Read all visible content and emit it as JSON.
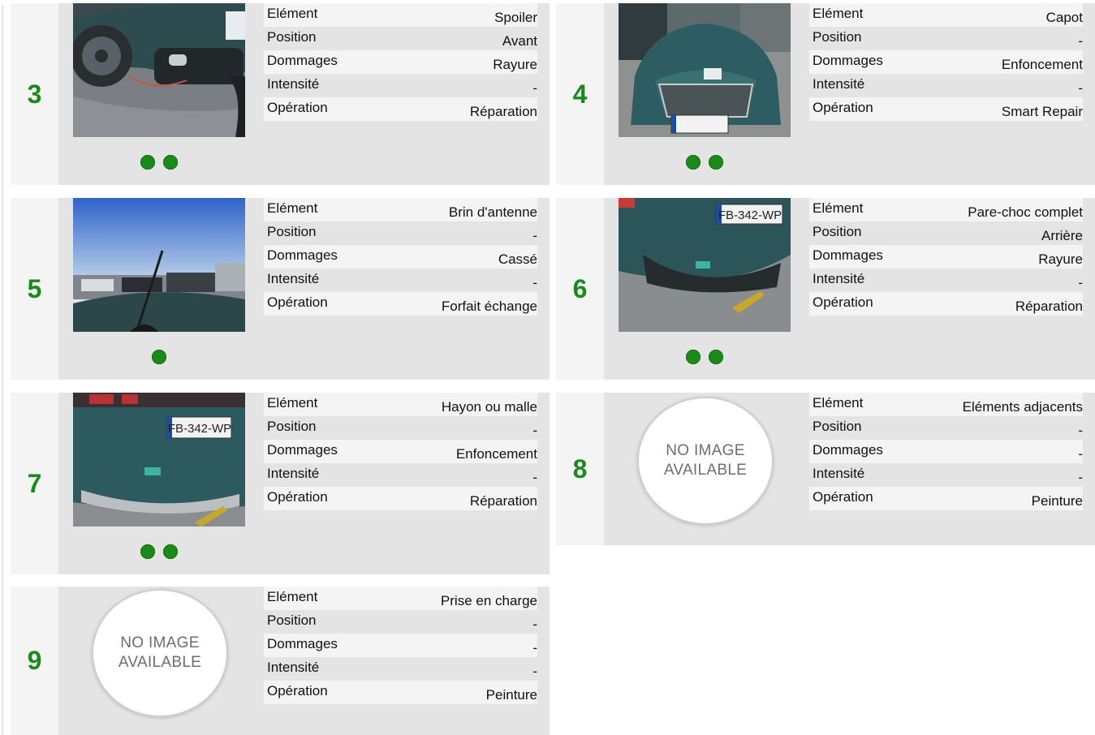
{
  "labels": {
    "element": "Elément",
    "position": "Position",
    "dommages": "Dommages",
    "intensite": "Intensité",
    "operation": "Opération"
  },
  "no_image_text": {
    "line1": "NO IMAGE",
    "line2": "AVAILABLE"
  },
  "colors": {
    "accent_green": "#1a8a1a",
    "card_bg": "#e4e4e4",
    "stripe_bg": "#f4f4f4"
  },
  "items": [
    {
      "number": "3",
      "element": "Spoiler",
      "position": "Avant",
      "dommages": "Rayure",
      "intensite": "-",
      "operation": "Réparation",
      "photo": "car front bumper close-up",
      "photo_count": 2
    },
    {
      "number": "4",
      "element": "Capot",
      "position": "-",
      "dommages": "Enfoncement",
      "intensite": "-",
      "operation": "Smart Repair",
      "photo": "car hood front view",
      "photo_count": 2
    },
    {
      "number": "5",
      "element": "Brin d'antenne",
      "position": "-",
      "dommages": "Cassé",
      "intensite": "-",
      "operation": "Forfait échange",
      "photo": "roof antenna parking lot",
      "photo_count": 1
    },
    {
      "number": "6",
      "element": "Pare-choc complet",
      "position": "Arrière",
      "dommages": "Rayure",
      "intensite": "-",
      "operation": "Réparation",
      "photo": "rear bumper with plate",
      "photo_count": 2
    },
    {
      "number": "7",
      "element": "Hayon ou malle",
      "position": "-",
      "dommages": "Enfoncement",
      "intensite": "-",
      "operation": "Réparation",
      "photo": "rear tailgate with plate",
      "photo_count": 2
    },
    {
      "number": "8",
      "element": "Eléments adjacents",
      "position": "-",
      "dommages": "-",
      "intensite": "-",
      "operation": "Peinture",
      "photo": "none",
      "photo_count": 0
    },
    {
      "number": "9",
      "element": "Prise en charge",
      "position": "-",
      "dommages": "-",
      "intensite": "-",
      "operation": "Peinture",
      "photo": "none",
      "photo_count": 0
    }
  ],
  "plates": {
    "rear": "FB-342-WP",
    "front_partial": "FB 342 WP"
  }
}
